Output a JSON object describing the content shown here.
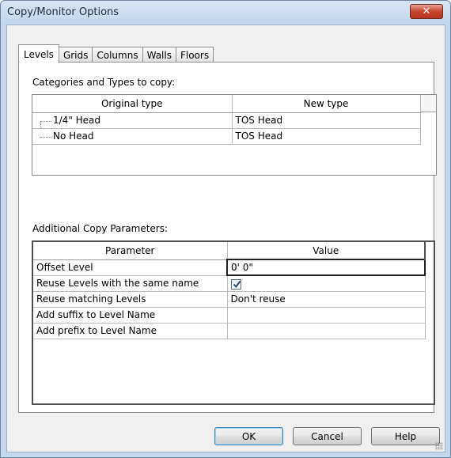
{
  "window": {
    "title": "Copy/Monitor Options",
    "close_symbol": "✕"
  },
  "tabs": [
    {
      "label": "Levels",
      "active": true
    },
    {
      "label": "Grids"
    },
    {
      "label": "Columns"
    },
    {
      "label": "Walls"
    },
    {
      "label": "Floors"
    }
  ],
  "categories": {
    "label": "Categories and Types to copy:",
    "columns": [
      "Original type",
      "New type"
    ],
    "rows": [
      {
        "original": "1/4\" Head",
        "new": "TOS Head"
      },
      {
        "original": "No Head",
        "new": "TOS Head"
      }
    ]
  },
  "additional": {
    "label": "Additional Copy Parameters:",
    "columns": [
      "Parameter",
      "Value"
    ],
    "rows": [
      {
        "param": "Offset Level",
        "value": "0'  0\""
      },
      {
        "param": "Reuse Levels with the same name",
        "value": "",
        "checked": true
      },
      {
        "param": "Reuse matching Levels",
        "value": "Don't reuse"
      },
      {
        "param": "Add suffix to Level Name",
        "value": ""
      },
      {
        "param": "Add prefix to Level Name",
        "value": ""
      }
    ]
  },
  "buttons": {
    "ok": "OK",
    "cancel": "Cancel",
    "help": "Help"
  },
  "icons": {
    "close": "close-icon",
    "checkbox": "check-icon",
    "grip": "resize-grip-icon"
  },
  "colors": {
    "title_bar": "#c5d7ec",
    "close_button": "#c7452f"
  }
}
